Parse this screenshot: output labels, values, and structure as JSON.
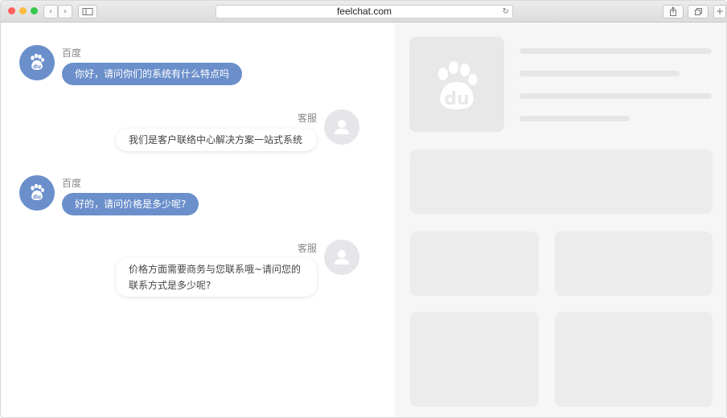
{
  "browser": {
    "url": "feelchat.com",
    "colors": {
      "close": "#fc605b",
      "minimize": "#fdbc40",
      "maximize": "#34c84a"
    }
  },
  "chat": {
    "messages": [
      {
        "sender": "百度",
        "text": "你好，请问你们的系统有什么特点吗"
      },
      {
        "sender": "客服",
        "text": "我们是客户联络中心解决方案一站式系统"
      },
      {
        "sender": "百度",
        "text": "好的，请问价格是多少呢?"
      },
      {
        "sender": "客服",
        "text": "价格方面需要商务与您联系哦~请问您的联系方式是多少呢?"
      }
    ],
    "colors": {
      "user_bubble": "#6b8fcb",
      "agent_avatar": "#e6e6ea"
    }
  },
  "sidebar": {
    "logo_text": "du"
  }
}
